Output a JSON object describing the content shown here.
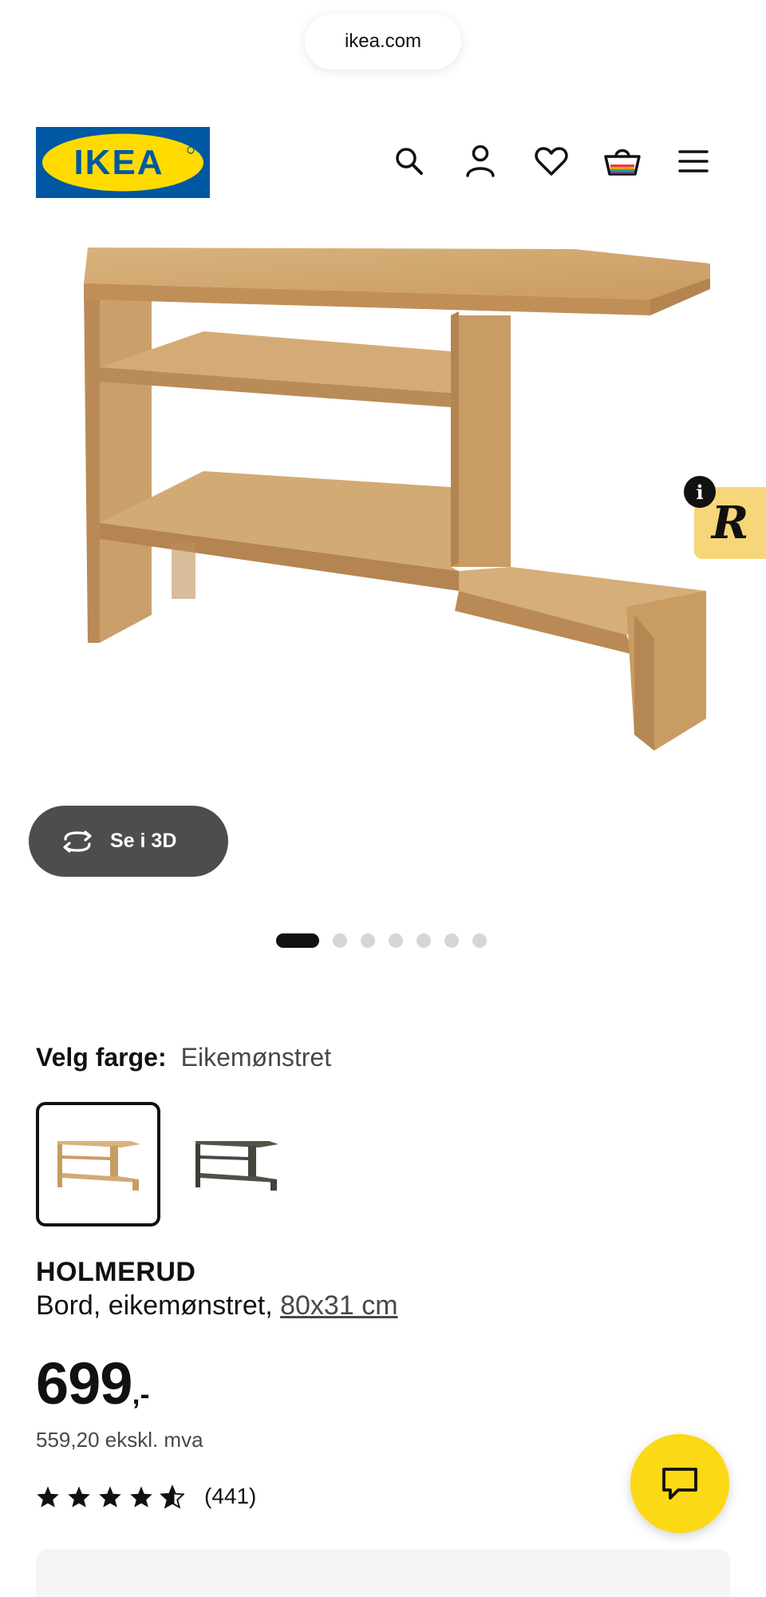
{
  "browser": {
    "url": "ikea.com"
  },
  "header": {
    "logo_text": "IKEA",
    "icons": [
      "search-icon",
      "account-icon",
      "heart-icon",
      "basket-icon",
      "menu-icon"
    ]
  },
  "gallery": {
    "view_3d_label": "Se i 3D",
    "page_count": 7,
    "active_page": 1
  },
  "color_picker": {
    "label": "Velg farge:",
    "selected_value": "Eikemønstret",
    "options": [
      "oak",
      "dark-brown"
    ]
  },
  "product": {
    "name": "HOLMERUD",
    "description": "Bord, eikemønstret, ",
    "size": "80x31 cm",
    "price": "699",
    "price_suffix": ",-",
    "price_ex_vat": "559,20 ekskl. mva",
    "rating_stars": 5,
    "review_count": "(441)"
  },
  "colors": {
    "ikea_blue": "#0058a3",
    "ikea_yellow": "#ffdb00",
    "chat_yellow": "#fbd914",
    "button_dark": "#4d4d4d"
  }
}
